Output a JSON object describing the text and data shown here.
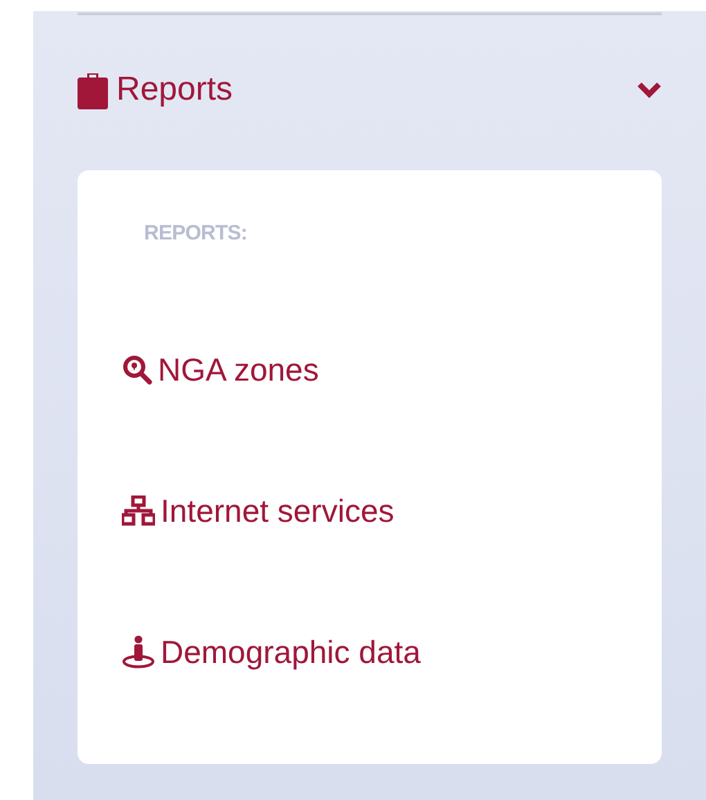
{
  "section": {
    "title": "Reports",
    "expanded": true,
    "menu": {
      "heading": "REPORTS:",
      "items": [
        {
          "label": "NGA zones",
          "kind": "search"
        },
        {
          "label": "Internet services",
          "kind": "network"
        },
        {
          "label": "Demographic data",
          "kind": "person"
        }
      ]
    }
  }
}
